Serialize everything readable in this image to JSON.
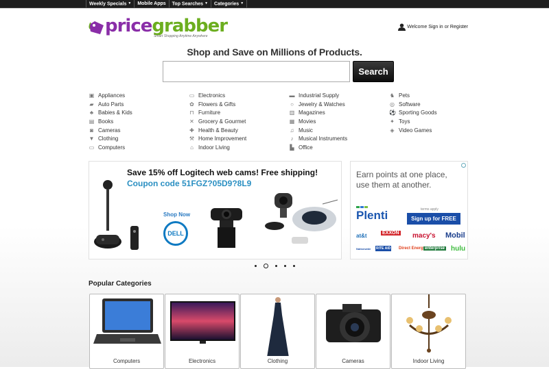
{
  "topnav": [
    {
      "label": "Weekly Specials",
      "has_dropdown": true
    },
    {
      "label": "Mobile Apps",
      "has_dropdown": false
    },
    {
      "label": "Top Searches",
      "has_dropdown": true
    },
    {
      "label": "Categories",
      "has_dropdown": true
    }
  ],
  "logo": {
    "part1": "price",
    "part2": "grabber",
    "tagline": "Smart Shopping Anytime Anywhere"
  },
  "account": {
    "welcome": "Welcome",
    "signin": "Sign in",
    "or": "or",
    "register": "Register"
  },
  "headline": "Shop and Save on Millions of Products.",
  "search": {
    "placeholder": "",
    "button": "Search"
  },
  "categories": [
    [
      {
        "label": "Appliances",
        "icon": "appliance-icon"
      },
      {
        "label": "Auto Parts",
        "icon": "car-icon"
      },
      {
        "label": "Babies & Kids",
        "icon": "stroller-icon"
      },
      {
        "label": "Books",
        "icon": "book-icon"
      },
      {
        "label": "Cameras",
        "icon": "camera-icon"
      },
      {
        "label": "Clothing",
        "icon": "shirt-icon"
      },
      {
        "label": "Computers",
        "icon": "computer-icon"
      }
    ],
    [
      {
        "label": "Electronics",
        "icon": "monitor-icon"
      },
      {
        "label": "Flowers & Gifts",
        "icon": "flower-icon"
      },
      {
        "label": "Furniture",
        "icon": "chair-icon"
      },
      {
        "label": "Grocery & Gourmet",
        "icon": "utensils-icon"
      },
      {
        "label": "Health & Beauty",
        "icon": "health-icon"
      },
      {
        "label": "Home Improvement",
        "icon": "wrench-icon"
      },
      {
        "label": "Indoor Living",
        "icon": "home-icon"
      }
    ],
    [
      {
        "label": "Industrial Supply",
        "icon": "truck-icon"
      },
      {
        "label": "Jewelry & Watches",
        "icon": "ring-icon"
      },
      {
        "label": "Magazines",
        "icon": "magazine-icon"
      },
      {
        "label": "Movies",
        "icon": "film-icon"
      },
      {
        "label": "Music",
        "icon": "music-note-icon"
      },
      {
        "label": "Musical Instruments",
        "icon": "guitar-icon"
      },
      {
        "label": "Office",
        "icon": "office-icon"
      }
    ],
    [
      {
        "label": "Pets",
        "icon": "paw-icon"
      },
      {
        "label": "Software",
        "icon": "disc-icon"
      },
      {
        "label": "Sporting Goods",
        "icon": "ball-icon"
      },
      {
        "label": "Toys",
        "icon": "toy-icon"
      },
      {
        "label": "Video Games",
        "icon": "gamepad-icon"
      }
    ]
  ],
  "banner": {
    "title": "Save 15% off Logitech web cams! Free shipping!",
    "coupon": "Coupon code 51FGZ?05D9?8L9",
    "shop_now": "Shop Now",
    "brand": "DELL"
  },
  "ad": {
    "headline": "Earn points at one place, use them at another.",
    "brand": "Plenti",
    "terms": "terms apply",
    "cta": "Sign up for FREE",
    "partners": [
      "at&t",
      "EXXON",
      "macy's",
      "Mobil",
      "Nationwide",
      "RITE AID",
      "Direct Energy",
      "enterprise",
      "hulu"
    ]
  },
  "carousel": {
    "count": 5,
    "active_index": 1
  },
  "popular": {
    "title": "Popular Categories",
    "tiles": [
      {
        "label": "Computers"
      },
      {
        "label": "Electronics"
      },
      {
        "label": "Clothing"
      },
      {
        "label": "Cameras"
      },
      {
        "label": "Indoor Living"
      }
    ]
  },
  "colors": {
    "brand_purple": "#8a2ea8",
    "brand_green": "#6cae1f",
    "link_blue": "#2a8fc2",
    "topbar": "#1e1e1e"
  }
}
